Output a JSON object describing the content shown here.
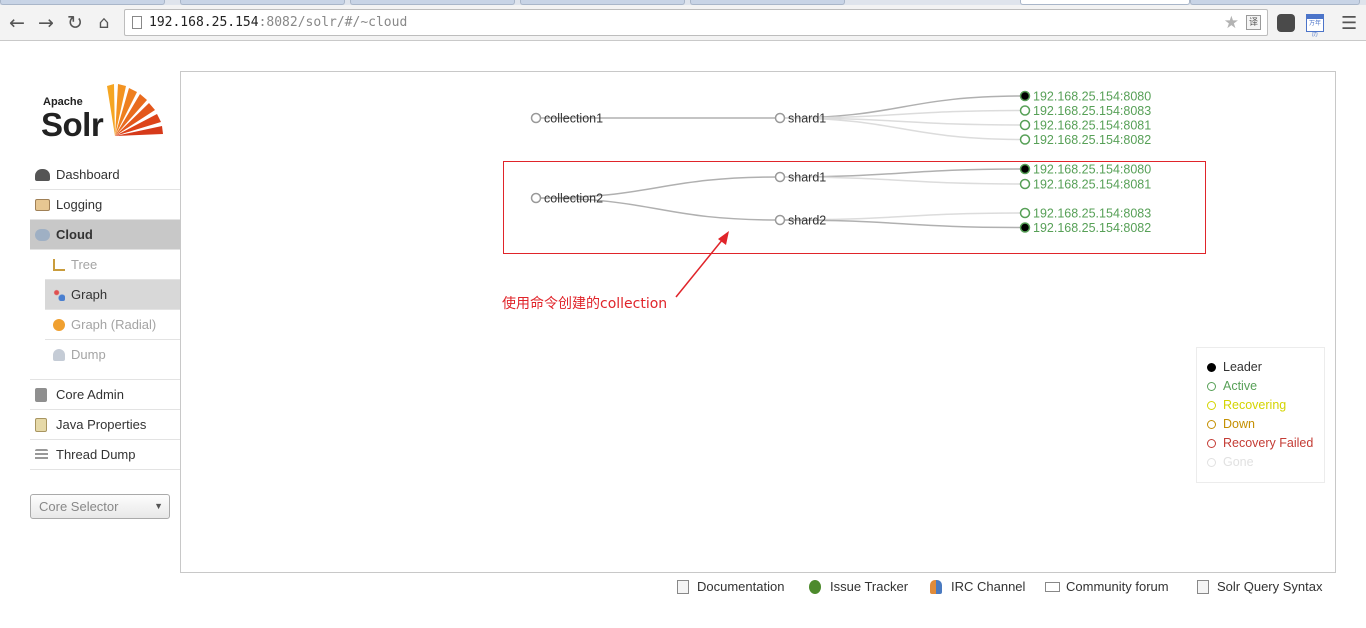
{
  "browser": {
    "url_host": "192.168.25.154",
    "url_path": ":8082/solr/#/~cloud",
    "translate_label": "译",
    "calendar_label": "万年历"
  },
  "logo": {
    "apache": "Apache",
    "solr": "Solr"
  },
  "sidebar": {
    "items": [
      {
        "label": "Dashboard",
        "icon": "dashboard-icon"
      },
      {
        "label": "Logging",
        "icon": "logging-icon"
      },
      {
        "label": "Cloud",
        "icon": "cloud-icon"
      }
    ],
    "cloud_sub": [
      {
        "label": "Tree",
        "icon": "tree-icon"
      },
      {
        "label": "Graph",
        "icon": "graph-icon"
      },
      {
        "label": "Graph (Radial)",
        "icon": "radial-graph-icon"
      },
      {
        "label": "Dump",
        "icon": "dump-icon"
      }
    ],
    "items2": [
      {
        "label": "Core Admin",
        "icon": "core-admin-icon"
      },
      {
        "label": "Java Properties",
        "icon": "java-properties-icon"
      },
      {
        "label": "Thread Dump",
        "icon": "thread-dump-icon"
      }
    ],
    "core_selector": "Core Selector"
  },
  "graph": {
    "collections": [
      {
        "name": "collection1",
        "shards": [
          {
            "name": "shard1",
            "replicas": [
              {
                "addr": "192.168.25.154:8080",
                "state": "leader"
              },
              {
                "addr": "192.168.25.154:8083",
                "state": "active"
              },
              {
                "addr": "192.168.25.154:8081",
                "state": "active"
              },
              {
                "addr": "192.168.25.154:8082",
                "state": "active"
              }
            ]
          }
        ]
      },
      {
        "name": "collection2",
        "shards": [
          {
            "name": "shard1",
            "replicas": [
              {
                "addr": "192.168.25.154:8080",
                "state": "leader"
              },
              {
                "addr": "192.168.25.154:8081",
                "state": "active"
              }
            ]
          },
          {
            "name": "shard2",
            "replicas": [
              {
                "addr": "192.168.25.154:8083",
                "state": "active"
              },
              {
                "addr": "192.168.25.154:8082",
                "state": "leader"
              }
            ]
          }
        ]
      }
    ]
  },
  "annotation": "使用命令创建的collection",
  "legend": [
    {
      "label": "Leader",
      "color": "#000000",
      "fill": "#000000"
    },
    {
      "label": "Active",
      "color": "#57a057",
      "fill": "#ffffff"
    },
    {
      "label": "Recovering",
      "color": "#d4d400",
      "fill": "#ffffff"
    },
    {
      "label": "Down",
      "color": "#c48f00",
      "fill": "#ffffff"
    },
    {
      "label": "Recovery Failed",
      "color": "#c43c35",
      "fill": "#ffffff"
    },
    {
      "label": "Gone",
      "color": "#e1e1e1",
      "fill": "#ffffff"
    }
  ],
  "footer": [
    {
      "label": "Documentation",
      "icon": "documentation-icon"
    },
    {
      "label": "Issue Tracker",
      "icon": "bug-icon"
    },
    {
      "label": "IRC Channel",
      "icon": "irc-icon"
    },
    {
      "label": "Community forum",
      "icon": "mail-icon"
    },
    {
      "label": "Solr Query Syntax",
      "icon": "query-syntax-icon"
    }
  ]
}
